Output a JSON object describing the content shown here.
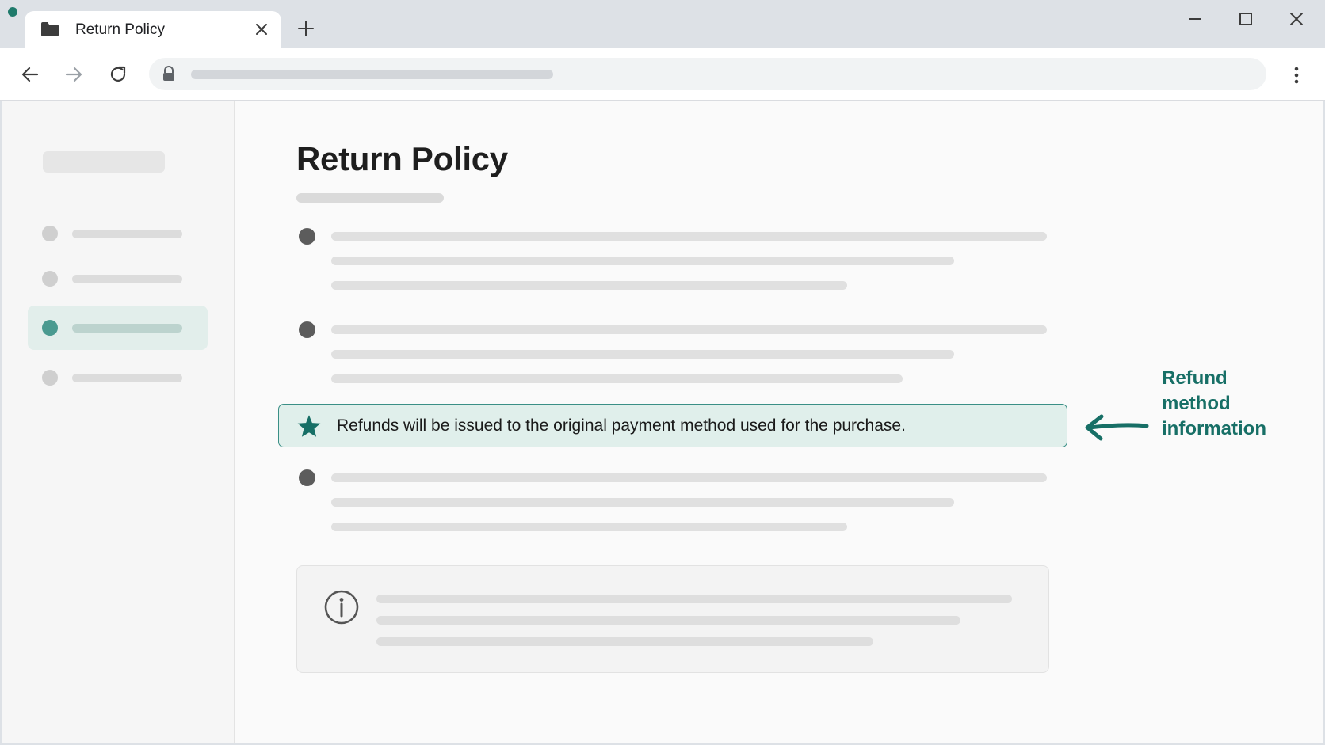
{
  "browser": {
    "tab_title": "Return Policy",
    "accent_color": "#1f7a6b"
  },
  "page": {
    "title": "Return Policy",
    "highlight_text": "Refunds will be issued to the original payment method used for the purchase.",
    "callout_lines": [
      "Refund",
      "method",
      "information"
    ]
  },
  "icons": {
    "tab": "folder-icon",
    "highlight": "star-icon",
    "info": "info-icon",
    "address": "lock-icon"
  },
  "colors": {
    "highlight_bg": "#e0efeb",
    "highlight_border": "#3a8f86",
    "callout_text": "#176f66",
    "active_sidebar_dot": "#4a9a90"
  }
}
